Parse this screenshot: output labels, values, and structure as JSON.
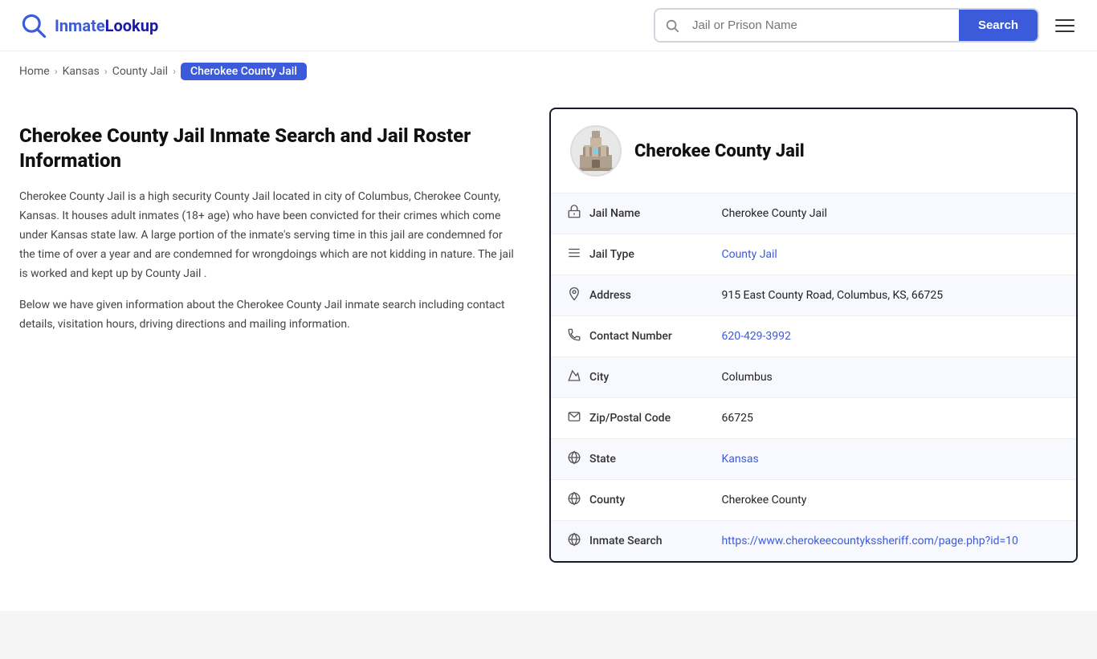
{
  "logo": {
    "text_part1": "Inmate",
    "text_part2": "Lookup"
  },
  "search": {
    "placeholder": "Jail or Prison Name",
    "button_label": "Search"
  },
  "breadcrumb": {
    "home": "Home",
    "kansas": "Kansas",
    "county_jail": "County Jail",
    "current": "Cherokee County Jail"
  },
  "left": {
    "title": "Cherokee County Jail Inmate Search and Jail Roster Information",
    "desc1": "Cherokee County Jail is a high security County Jail located in city of Columbus, Cherokee County, Kansas. It houses adult inmates (18+ age) who have been convicted for their crimes which come under Kansas state law. A large portion of the inmate's serving time in this jail are condemned for the time of over a year and are condemned for wrongdoings which are not kidding in nature. The jail is worked and kept up by County Jail .",
    "desc2": "Below we have given information about the Cherokee County Jail inmate search including contact details, visitation hours, driving directions and mailing information."
  },
  "card": {
    "jail_name_header": "Cherokee County Jail",
    "rows": [
      {
        "icon": "jail-icon",
        "label": "Jail Name",
        "value": "Cherokee County Jail",
        "link": null
      },
      {
        "icon": "list-icon",
        "label": "Jail Type",
        "value": "County Jail",
        "link": "#"
      },
      {
        "icon": "location-icon",
        "label": "Address",
        "value": "915 East County Road, Columbus, KS, 66725",
        "link": null
      },
      {
        "icon": "phone-icon",
        "label": "Contact Number",
        "value": "620-429-3992",
        "link": "tel:620-429-3992"
      },
      {
        "icon": "city-icon",
        "label": "City",
        "value": "Columbus",
        "link": null
      },
      {
        "icon": "zip-icon",
        "label": "Zip/Postal Code",
        "value": "66725",
        "link": null
      },
      {
        "icon": "globe-icon",
        "label": "State",
        "value": "Kansas",
        "link": "#"
      },
      {
        "icon": "county-icon",
        "label": "County",
        "value": "Cherokee County",
        "link": null
      },
      {
        "icon": "search-globe-icon",
        "label": "Inmate Search",
        "value": "https://www.cherokeecountykssheriff.com/page.php?id=10",
        "link": "https://www.cherokeecountykssheriff.com/page.php?id=10"
      }
    ]
  },
  "icons": {
    "jail-icon": "🏛",
    "list-icon": "≡",
    "location-icon": "📍",
    "phone-icon": "📞",
    "city-icon": "🗺",
    "zip-icon": "✉",
    "globe-icon": "🌐",
    "county-icon": "🌐",
    "search-globe-icon": "🌐"
  }
}
